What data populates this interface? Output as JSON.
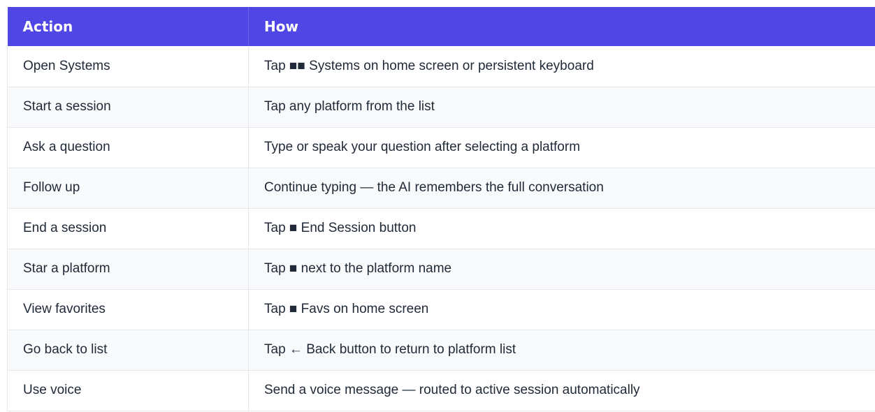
{
  "table": {
    "headers": [
      "Action",
      "How"
    ],
    "rows": [
      [
        "Open Systems",
        "Tap ■■ Systems on home screen or persistent keyboard"
      ],
      [
        "Start a session",
        "Tap any platform from the list"
      ],
      [
        "Ask a question",
        "Type or speak your question after selecting a platform"
      ],
      [
        "Follow up",
        "Continue typing — the AI remembers the full conversation"
      ],
      [
        "End a session",
        "Tap ■ End Session button"
      ],
      [
        "Star a platform",
        "Tap ■ next to the platform name"
      ],
      [
        "View favorites",
        "Tap ■ Favs on home screen"
      ],
      [
        "Go back to list",
        "Tap ← Back button to return to platform list"
      ],
      [
        "Use voice",
        "Send a voice message — routed to active session automatically"
      ]
    ]
  },
  "colors": {
    "header_bg": "#4f46e5",
    "header_text": "#ffffff",
    "row_alt_bg": "#f9fafb",
    "border": "#e5e7eb"
  }
}
